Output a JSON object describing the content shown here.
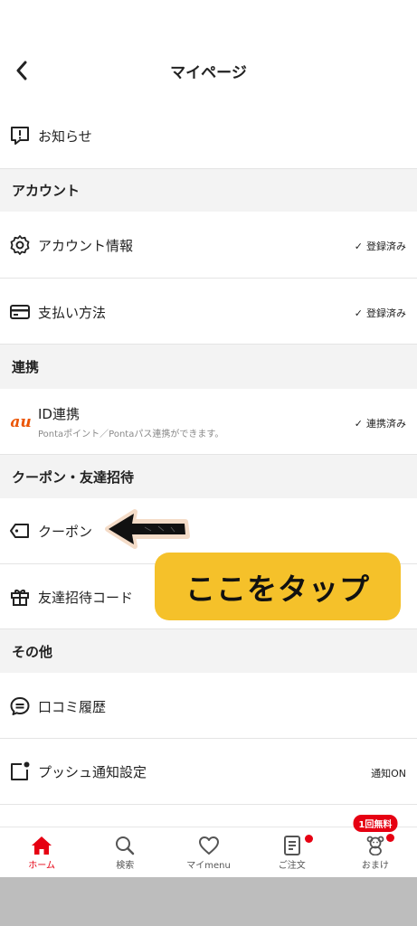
{
  "header": {
    "title": "マイページ"
  },
  "rows": {
    "notice": {
      "label": "お知らせ"
    },
    "account_info": {
      "label": "アカウント情報",
      "status": "登録済み"
    },
    "payment": {
      "label": "支払い方法",
      "status": "登録済み"
    },
    "id_link": {
      "label": "ID連携",
      "sub": "Pontaポイント／Pontaパス連携ができます。",
      "status": "連携済み",
      "logo": "au"
    },
    "coupon": {
      "label": "クーポン"
    },
    "invite_code": {
      "label": "友達招待コード"
    },
    "reviews": {
      "label": "口コミ履歴"
    },
    "push": {
      "label": "プッシュ通知設定",
      "status": "通知ON"
    }
  },
  "sections": {
    "account": "アカウント",
    "link": "連携",
    "coupon_invite": "クーポン・友達招待",
    "other": "その他"
  },
  "overlay": {
    "text": "ここをタップ"
  },
  "tabbar": {
    "home": "ホーム",
    "search": "検索",
    "mymenu": "マイmenu",
    "orders": "ご注文",
    "bonus": "おまけ",
    "bonus_badge": "1回無料"
  },
  "colors": {
    "accent": "#e60012",
    "overlay": "#f5c12a",
    "section_bg": "#f3f3f3"
  }
}
